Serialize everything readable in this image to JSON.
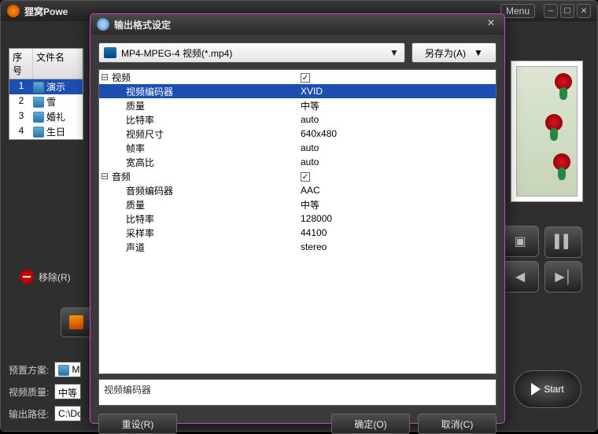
{
  "app": {
    "title": "狸窝Powe",
    "menu": "Menu"
  },
  "filelist": {
    "cols": {
      "num": "序号",
      "name": "文件名"
    },
    "rows": [
      {
        "num": "1",
        "name": "演示",
        "selected": true
      },
      {
        "num": "2",
        "name": "雪"
      },
      {
        "num": "3",
        "name": "婚礼"
      },
      {
        "num": "4",
        "name": "生日"
      }
    ]
  },
  "remove_label": "移除(R)",
  "bottom": {
    "preset_label": "预置方案:",
    "preset_value": "M",
    "quality_label": "视频质量:",
    "quality_value": "中等",
    "output_label": "输出路径:",
    "output_value": "C:\\Doc"
  },
  "start_label": "Start",
  "dialog": {
    "title": "输出格式设定",
    "format": "MP4-MPEG-4 视频(*.mp4)",
    "save_as": "另存为(A)",
    "groups": [
      {
        "label": "视频",
        "checked": true,
        "items": [
          {
            "k": "视频编码器",
            "v": "XVID",
            "selected": true
          },
          {
            "k": "质量",
            "v": "中等"
          },
          {
            "k": "比特率",
            "v": "auto"
          },
          {
            "k": "视频尺寸",
            "v": "640x480"
          },
          {
            "k": "帧率",
            "v": "auto"
          },
          {
            "k": "宽高比",
            "v": "auto"
          }
        ]
      },
      {
        "label": "音频",
        "checked": true,
        "items": [
          {
            "k": "音频编码器",
            "v": "AAC"
          },
          {
            "k": "质量",
            "v": "中等"
          },
          {
            "k": "比特率",
            "v": "128000"
          },
          {
            "k": "采样率",
            "v": "44100"
          },
          {
            "k": "声道",
            "v": "stereo"
          }
        ]
      }
    ],
    "description": "视频编码器",
    "buttons": {
      "reset": "重设(R)",
      "ok": "确定(O)",
      "cancel": "取消(C)"
    }
  }
}
